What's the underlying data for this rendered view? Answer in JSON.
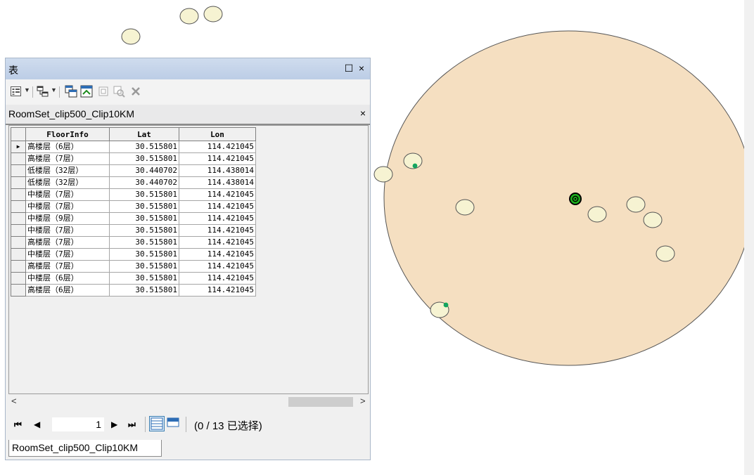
{
  "window": {
    "title": "表",
    "restore_glyph": "☐",
    "close_glyph": "×"
  },
  "toolbar": {
    "icons": [
      "table-options-icon",
      "related-tables-icon",
      "select-by-attributes-icon",
      "switch-selection-icon",
      "clear-selection-icon",
      "zoom-to-selected-icon",
      "delete-selected-icon"
    ]
  },
  "table": {
    "name": "RoomSet_clip500_Clip10KM",
    "close_glyph": "×",
    "columns": [
      "FloorInfo",
      "Lat",
      "Lon"
    ],
    "rows": [
      {
        "floor": "高楼层（6层）",
        "lat": "30.515801",
        "lon": "114.421045"
      },
      {
        "floor": "高楼层（7层）",
        "lat": "30.515801",
        "lon": "114.421045"
      },
      {
        "floor": "低楼层（32层）",
        "lat": "30.440702",
        "lon": "114.438014"
      },
      {
        "floor": "低楼层（32层）",
        "lat": "30.440702",
        "lon": "114.438014"
      },
      {
        "floor": "中楼层（7层）",
        "lat": "30.515801",
        "lon": "114.421045"
      },
      {
        "floor": "中楼层（7层）",
        "lat": "30.515801",
        "lon": "114.421045"
      },
      {
        "floor": "中楼层（9层）",
        "lat": "30.515801",
        "lon": "114.421045"
      },
      {
        "floor": "中楼层（7层）",
        "lat": "30.515801",
        "lon": "114.421045"
      },
      {
        "floor": "高楼层（7层）",
        "lat": "30.515801",
        "lon": "114.421045"
      },
      {
        "floor": "中楼层（7层）",
        "lat": "30.515801",
        "lon": "114.421045"
      },
      {
        "floor": "高楼层（7层）",
        "lat": "30.515801",
        "lon": "114.421045"
      },
      {
        "floor": "中楼层（6层）",
        "lat": "30.515801",
        "lon": "114.421045"
      },
      {
        "floor": "高楼层（6层）",
        "lat": "30.515801",
        "lon": "114.421045"
      }
    ],
    "current_row_marker": "▶"
  },
  "navigation": {
    "first": "⏮",
    "prev": "◀",
    "current_record": "1",
    "next": "▶",
    "last": "⏭",
    "selection_count": "(0 / 13 已选择)"
  },
  "scroll": {
    "left_arrow": "<",
    "right_arrow": ">"
  },
  "bottom_tab": {
    "label": "RoomSet_clip500_Clip10KM"
  },
  "colors": {
    "buffer_fill": "#f5dfc1",
    "point_fill": "#f6f3d2",
    "title_bar": "#c7d7ec",
    "center_marker": "#1a9c1a"
  }
}
